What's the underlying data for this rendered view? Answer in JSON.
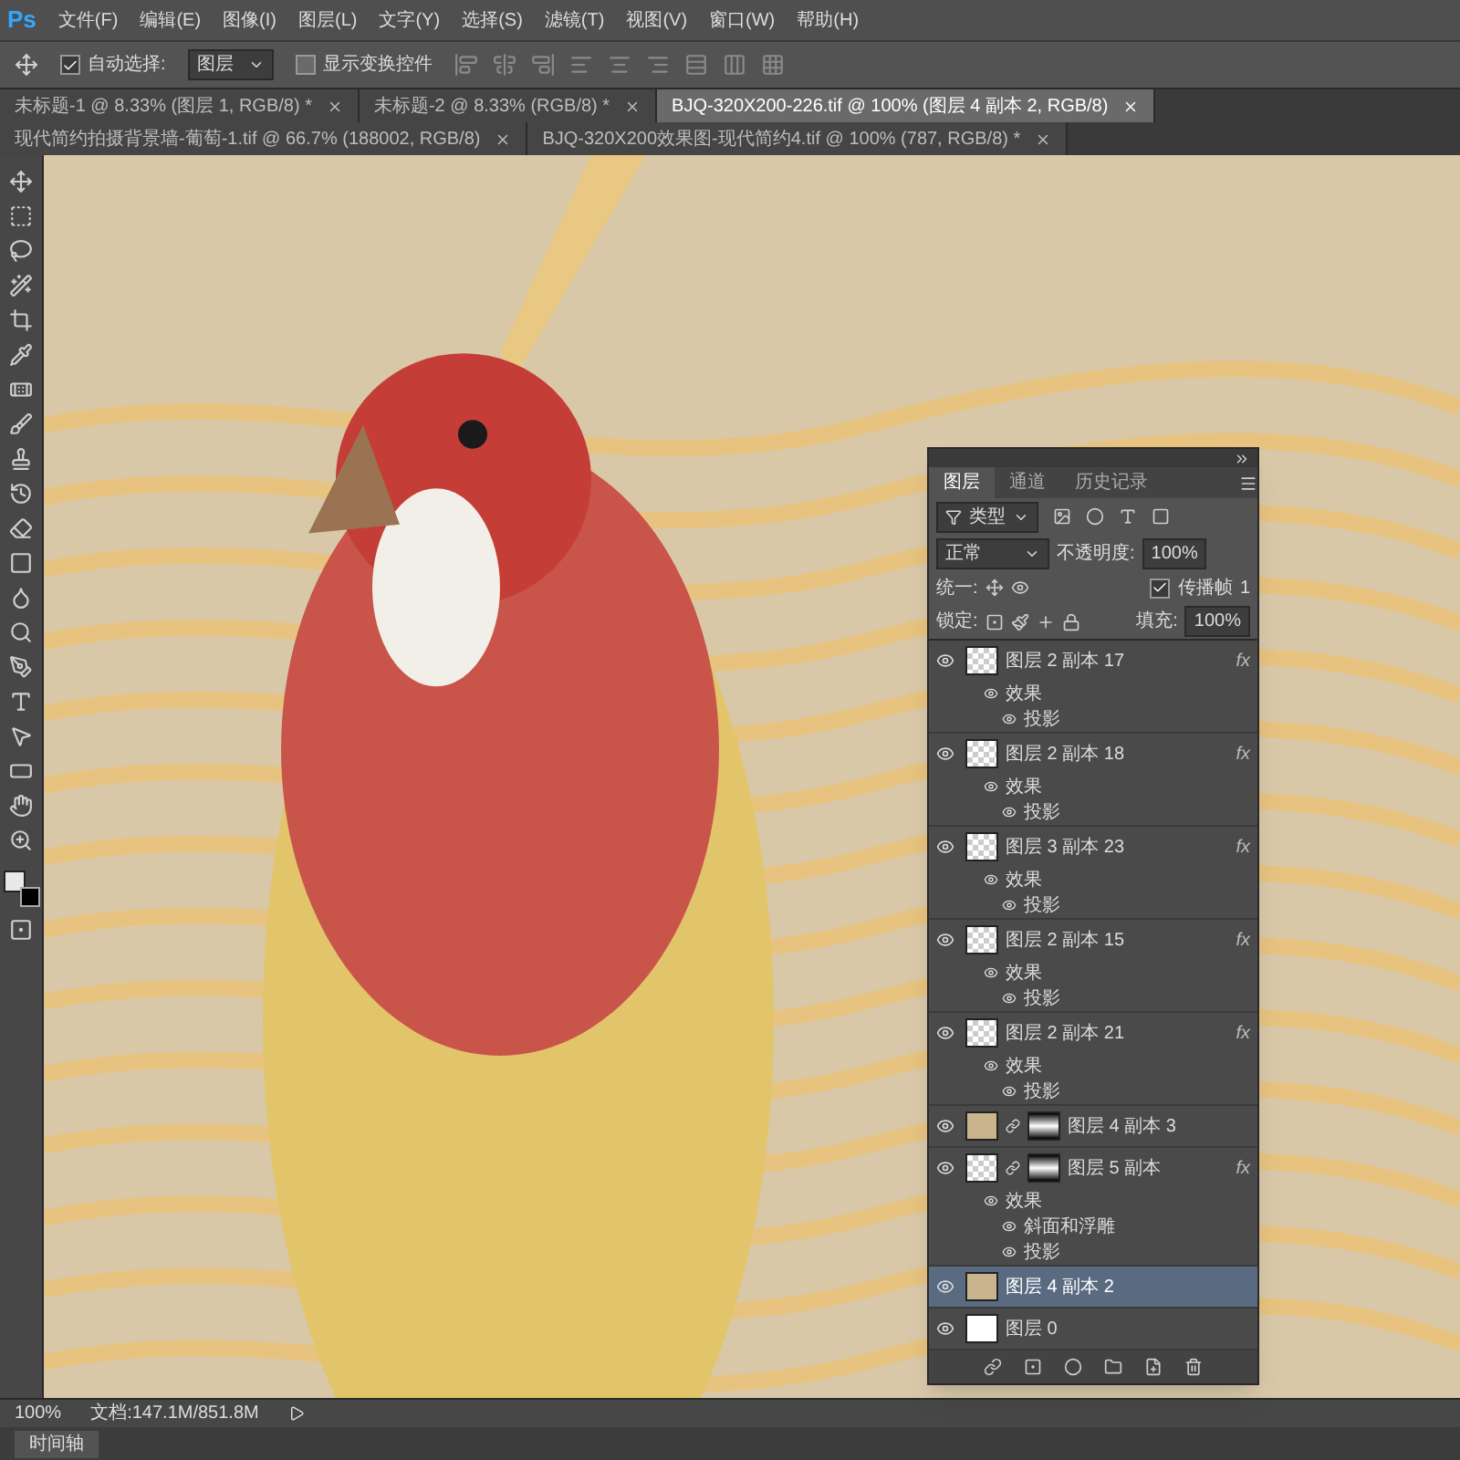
{
  "app_logo": "Ps",
  "menu": [
    "文件(F)",
    "编辑(E)",
    "图像(I)",
    "图层(L)",
    "文字(Y)",
    "选择(S)",
    "滤镜(T)",
    "视图(V)",
    "窗口(W)",
    "帮助(H)"
  ],
  "options_bar": {
    "auto_select": {
      "label": "自动选择:",
      "checked": true
    },
    "target": "图层",
    "show_transform": {
      "label": "显示变换控件",
      "checked": false
    }
  },
  "document_tabs": [
    {
      "title": "未标题-1 @ 8.33% (图层 1, RGB/8) *",
      "selected": false
    },
    {
      "title": "未标题-2 @ 8.33% (RGB/8) *",
      "selected": false
    },
    {
      "title": "BJQ-320X200-226.tif @ 100% (图层 4 副本 2, RGB/8)",
      "selected": true
    },
    {
      "title": "现代简约拍摄背景墙-葡萄-1.tif @ 66.7% (188002, RGB/8)",
      "selected": false
    },
    {
      "title": "BJQ-320X200效果图-现代简约4.tif @ 100% (787, RGB/8) *",
      "selected": false
    }
  ],
  "layers_panel": {
    "tabs": [
      {
        "label": "图层",
        "selected": true
      },
      {
        "label": "通道",
        "selected": false
      },
      {
        "label": "历史记录",
        "selected": false
      }
    ],
    "filter": "类型",
    "blend_mode": "正常",
    "opacity_label": "不透明度:",
    "opacity": "100%",
    "unify_label": "统一:",
    "propagate": {
      "label": "传播帧",
      "checked": true,
      "value": "1"
    },
    "lock_label": "锁定:",
    "fill_label": "填充:",
    "fill": "100%",
    "layers": [
      {
        "name": "图层 2 副本 17",
        "visible": true,
        "selected": false,
        "kind": "transparent",
        "mask": false,
        "fx": "fx",
        "effects": {
          "label": "效果",
          "children": [
            "投影"
          ]
        }
      },
      {
        "name": "图层 2 副本 18",
        "visible": true,
        "selected": false,
        "kind": "transparent",
        "mask": false,
        "fx": "fx",
        "effects": {
          "label": "效果",
          "children": [
            "投影"
          ]
        }
      },
      {
        "name": "图层 3 副本 23",
        "visible": true,
        "selected": false,
        "kind": "transparent",
        "mask": false,
        "fx": "fx",
        "effects": {
          "label": "效果",
          "children": [
            "投影"
          ]
        }
      },
      {
        "name": "图层 2 副本 15",
        "visible": true,
        "selected": false,
        "kind": "transparent",
        "mask": false,
        "fx": "fx",
        "effects": {
          "label": "效果",
          "children": [
            "投影"
          ]
        }
      },
      {
        "name": "图层 2 副本 21",
        "visible": true,
        "selected": false,
        "kind": "transparent",
        "mask": false,
        "fx": "fx",
        "effects": {
          "label": "效果",
          "children": [
            "投影"
          ]
        }
      },
      {
        "name": "图层 4 副本 3",
        "visible": true,
        "selected": false,
        "kind": "tan",
        "mask": true
      },
      {
        "name": "图层 5 副本",
        "visible": true,
        "selected": false,
        "kind": "transparent",
        "mask": true,
        "fx": "fx",
        "effects": {
          "label": "效果",
          "children": [
            "斜面和浮雕",
            "投影"
          ]
        }
      },
      {
        "name": "图层 4 副本 2",
        "visible": true,
        "selected": true,
        "kind": "tan",
        "mask": false
      },
      {
        "name": "图层 0",
        "visible": true,
        "selected": false,
        "kind": "white",
        "mask": false
      }
    ]
  },
  "status_bar": {
    "zoom": "100%",
    "document_size": "文档:147.1M/851.8M"
  },
  "timeline_tab": "时间轴"
}
